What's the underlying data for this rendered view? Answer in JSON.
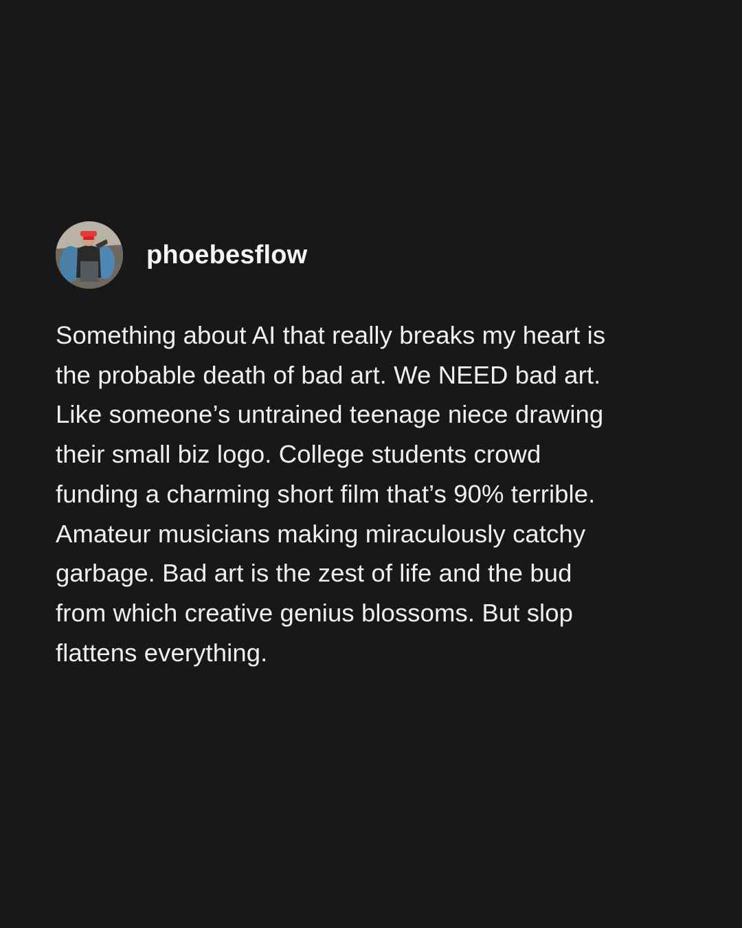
{
  "post": {
    "username": "phoebesflow",
    "avatar_icon": "profile-photo",
    "lines": [
      "Something about AI that really breaks my heart is",
      "the probable death of bad art. We NEED bad art.",
      "Like someone’s untrained teenage niece drawing",
      "their small biz logo. College students crowd",
      "funding a charming short film that’s 90% terrible.",
      "Amateur musicians making miraculously catchy",
      "garbage. Bad art is the zest of life and the bud",
      "from which creative genius blossoms. But slop",
      "flattens everything."
    ]
  },
  "colors": {
    "background": "#181818",
    "text": "#f0f0f0"
  }
}
